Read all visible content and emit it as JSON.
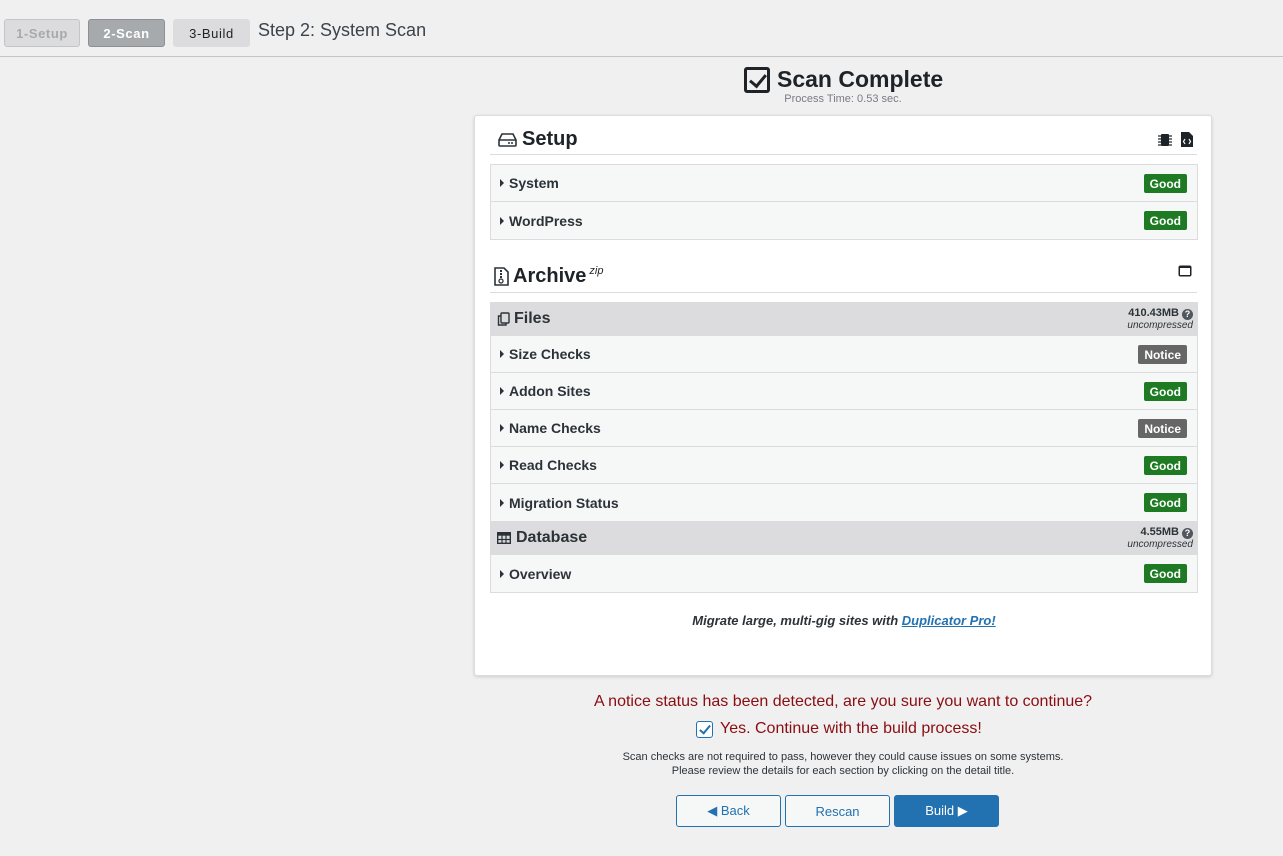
{
  "steps": {
    "step1": "1-Setup",
    "step2": "2-Scan",
    "step3": "3-Build",
    "title": "Step 2: System Scan"
  },
  "scan": {
    "title": "Scan Complete",
    "process_time": "Process Time: 0.53 sec."
  },
  "setup": {
    "title": "Setup",
    "rows": [
      {
        "label": "System",
        "status": "Good"
      },
      {
        "label": "WordPress",
        "status": "Good"
      }
    ]
  },
  "archive": {
    "title": "Archive",
    "format": "zip",
    "files": {
      "title": "Files",
      "size": "410.43MB",
      "size_note": "uncompressed",
      "rows": [
        {
          "label": "Size Checks",
          "status": "Notice"
        },
        {
          "label": "Addon Sites",
          "status": "Good"
        },
        {
          "label": "Name Checks",
          "status": "Notice"
        },
        {
          "label": "Read Checks",
          "status": "Good"
        },
        {
          "label": "Migration Status",
          "status": "Good"
        }
      ]
    },
    "database": {
      "title": "Database",
      "size": "4.55MB",
      "size_note": "uncompressed",
      "rows": [
        {
          "label": "Overview",
          "status": "Good"
        }
      ]
    }
  },
  "promo": {
    "text": "Migrate large, multi-gig sites with ",
    "link": "Duplicator Pro!"
  },
  "notice": {
    "question": "A notice status has been detected, are you sure you want to continue?",
    "confirm": "Yes. Continue with the build process!",
    "hint_line1": "Scan checks are not required to pass, however they could cause issues on some systems.",
    "hint_line2": "Please review the details for each section by clicking on the detail title."
  },
  "buttons": {
    "back": "◀ Back",
    "rescan": "Rescan",
    "build": "Build ▶"
  },
  "colors": {
    "good": "#1e7b23",
    "notice": "#666666",
    "accent": "#2271b1",
    "warning_text": "#8a0d12"
  }
}
